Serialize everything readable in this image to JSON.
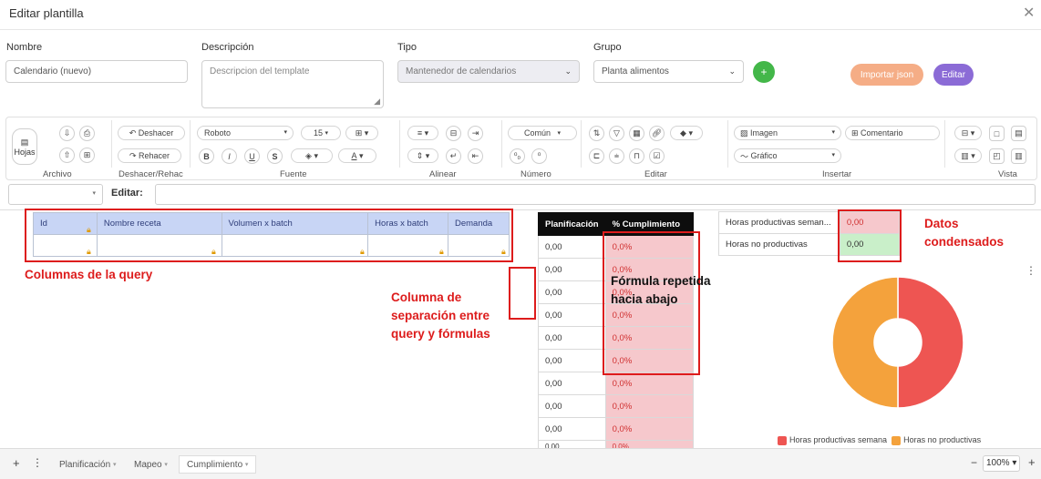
{
  "dialog": {
    "title": "Editar plantilla"
  },
  "form": {
    "nombre_label": "Nombre",
    "nombre_value": "Calendario (nuevo)",
    "descripcion_label": "Descripción",
    "descripcion_placeholder": "Descripcion del template",
    "tipo_label": "Tipo",
    "tipo_value": "Mantenedor de calendarios",
    "grupo_label": "Grupo",
    "grupo_value": "Planta alimentos",
    "add_button": "+",
    "importar_button": "Importar json",
    "editar_button": "Editar"
  },
  "toolbar": {
    "archivo": {
      "label": "Archivo",
      "hojas": "Hojas"
    },
    "deshacer": {
      "label": "Deshacer/Rehac",
      "undo": "Deshacer",
      "redo": "Rehacer"
    },
    "fuente": {
      "label": "Fuente",
      "font": "Roboto",
      "size": "15",
      "bold": "B",
      "italic": "I",
      "underline": "U",
      "strike": "S"
    },
    "alinear": {
      "label": "Alinear"
    },
    "numero": {
      "label": "Número",
      "format": "Común"
    },
    "editar": {
      "label": "Editar"
    },
    "insertar": {
      "label": "Insertar",
      "imagen": "Imagen",
      "comentario": "Comentario",
      "grafico": "Gráfico"
    },
    "vista": {
      "label": "Vista"
    }
  },
  "formula_bar": {
    "label": "Editar:",
    "cell_ref": "",
    "value": ""
  },
  "query_table": {
    "headers": [
      "Id",
      "Nombre receta",
      "Volumen x batch",
      "Horas x batch",
      "Demanda"
    ]
  },
  "formula_table": {
    "headers": [
      "Planificación",
      "% Cumplimiento"
    ],
    "rows": [
      [
        "0,00",
        "0,0%"
      ],
      [
        "0,00",
        "0,0%"
      ],
      [
        "0,00",
        "0,0%"
      ],
      [
        "0,00",
        "0,0%"
      ],
      [
        "0,00",
        "0,0%"
      ],
      [
        "0,00",
        "0,0%"
      ],
      [
        "0,00",
        "0,0%"
      ],
      [
        "0,00",
        "0,0%"
      ],
      [
        "0,00",
        "0,0%"
      ]
    ],
    "partial_row": [
      "0.00",
      "0.0%"
    ]
  },
  "summary_table": {
    "rows": [
      {
        "label": "Horas productivas seman...",
        "value": "0,00",
        "color": "#f6c8cc"
      },
      {
        "label": "Horas no productivas",
        "value": "0,00",
        "color": "#c9efc9"
      }
    ]
  },
  "chart_data": {
    "type": "pie",
    "donut": true,
    "labels": [
      "Horas productivas semana",
      "Horas no productivas"
    ],
    "values": [
      50,
      50
    ],
    "colors": [
      "#ee5552",
      "#f4a23c"
    ],
    "legend_position": "bottom"
  },
  "annotations": {
    "columnas": "Columnas de la query",
    "separacion": "Columna de separación entre query y fórmulas",
    "formula": "Fórmula repetida hacia abajo",
    "datos": "Datos condensados"
  },
  "sheets": {
    "tabs": [
      "Planificación",
      "Mapeo",
      "Cumplimiento"
    ],
    "active": "Cumplimiento",
    "zoom": "100%"
  }
}
